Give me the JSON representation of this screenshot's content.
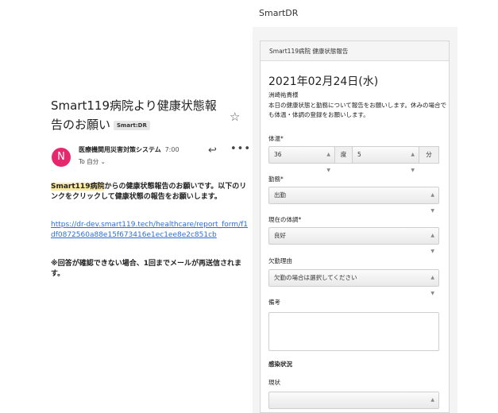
{
  "email": {
    "subject": "Smart119病院より健康状態報告のお願い",
    "subject_tag": "Smart:DR",
    "avatar_letter": "N",
    "sender": "医療機関用災害対策システム",
    "time": "7:00",
    "recipient": "To 自分 ⌄",
    "body_highlight": "Smart119病院",
    "body_rest": "からの健康状態報告のお願いです。以下のリンクをクリックして健康状態の報告をお願いします。",
    "link": "https://dr-dev.smart119.tech/healthcare/report_form/f1df0872560a88e15f673416e1ec1ee8e2c851cb",
    "note": "※回答が確認できない場合、1回までメールが再送信されます。"
  },
  "app": {
    "title": "SmartDR"
  },
  "form": {
    "header": "Smart119病院 健康状態報告",
    "date": "2021年02月24日(水)",
    "name": "洲崎祐貴様",
    "desc": "本日の健康状態と勤務について報告をお願いします。休みの場合でも体温・体調の登録をお願いします。",
    "temp_label": "体温*",
    "temp_int": "36",
    "temp_unit_deg": "度",
    "temp_dec": "5",
    "temp_unit_min": "分",
    "work_label": "勤務*",
    "work_value": "出勤",
    "condition_label": "現在の体調*",
    "condition_value": "良好",
    "absence_label": "欠勤理由",
    "absence_placeholder": "欠勤の場合は選択してください",
    "remarks_label": "備考",
    "infection_heading": "感染状況",
    "status_label": "現状"
  }
}
